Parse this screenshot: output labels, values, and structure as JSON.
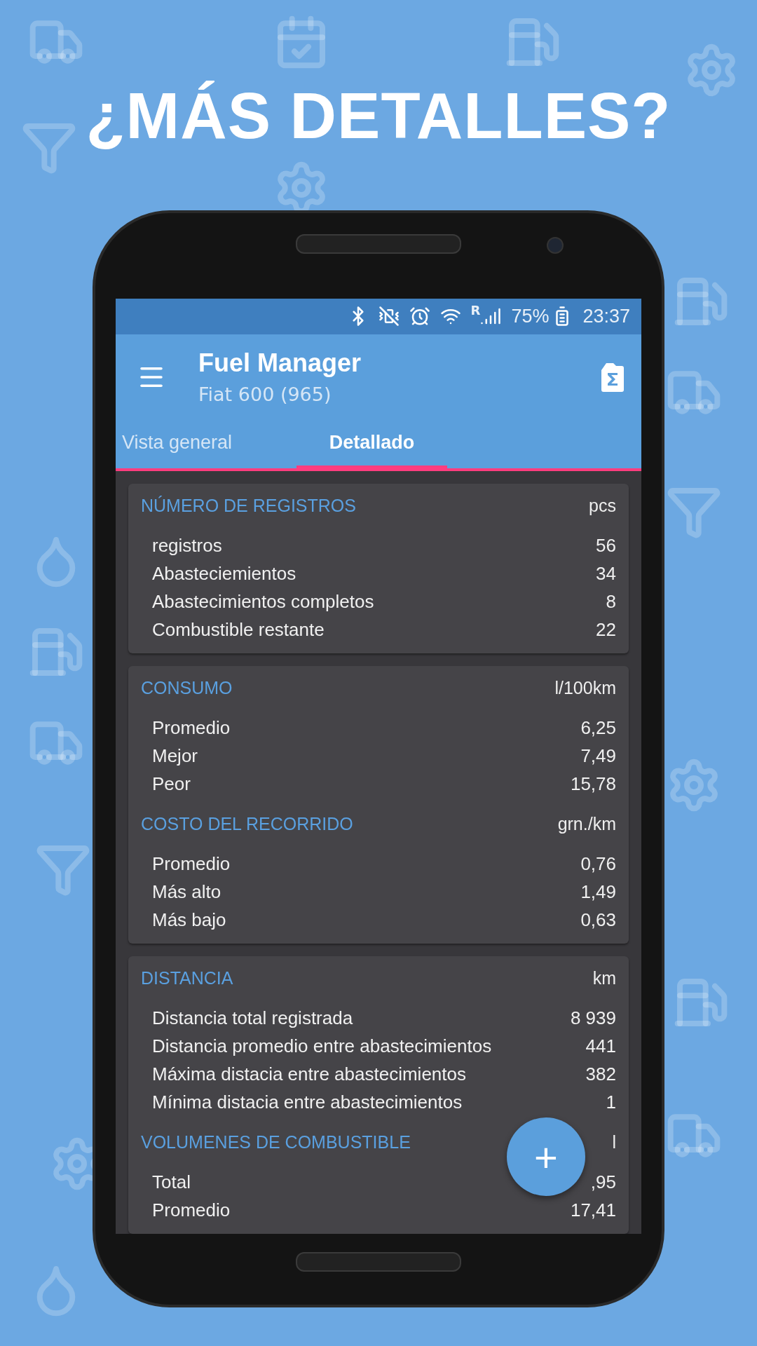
{
  "headline": "¿MÁS DETALLES?",
  "status_bar": {
    "network_letter": "R",
    "battery": "75%",
    "time": "23:37"
  },
  "toolbar": {
    "title": "Fuel Manager",
    "subtitle": "Fiat 600 (965)"
  },
  "tabs": [
    {
      "label": "Vista general",
      "selected": false
    },
    {
      "label": "Detallado",
      "selected": true
    }
  ],
  "cards": [
    {
      "groups": [
        {
          "title": "NÚMERO DE REGISTROS",
          "unit": "pcs",
          "rows": [
            {
              "label": "registros",
              "value": "56"
            },
            {
              "label": "Abasteciemientos",
              "value": "34"
            },
            {
              "label": "Abastecimientos completos",
              "value": "8"
            },
            {
              "label": "Combustible restante",
              "value": "22"
            }
          ]
        }
      ]
    },
    {
      "groups": [
        {
          "title": "CONSUMO",
          "unit": "l/100km",
          "rows": [
            {
              "label": "Promedio",
              "value": "6,25"
            },
            {
              "label": "Mejor",
              "value": "7,49"
            },
            {
              "label": "Peor",
              "value": "15,78"
            }
          ]
        },
        {
          "title": "COSTO DEL RECORRIDO",
          "unit": "grn./km",
          "rows": [
            {
              "label": "Promedio",
              "value": "0,76"
            },
            {
              "label": "Más alto",
              "value": "1,49"
            },
            {
              "label": "Más bajo",
              "value": "0,63"
            }
          ]
        }
      ]
    },
    {
      "groups": [
        {
          "title": "DISTANCIA",
          "unit": "km",
          "rows": [
            {
              "label": "Distancia total registrada",
              "value": "8 939"
            },
            {
              "label": "Distancia promedio entre abastecimientos",
              "value": "441"
            },
            {
              "label": "Máxima distacia entre abastecimientos",
              "value": "382"
            },
            {
              "label": "Mínima distacia entre abastecimientos",
              "value": "1"
            }
          ]
        },
        {
          "title": "VOLUMENES DE COMBUSTIBLE",
          "unit": "l",
          "rows": [
            {
              "label": "Total",
              "value": ",95"
            },
            {
              "label": "Promedio",
              "value": "17,41"
            }
          ]
        }
      ]
    }
  ],
  "fab": {
    "label": "+"
  }
}
